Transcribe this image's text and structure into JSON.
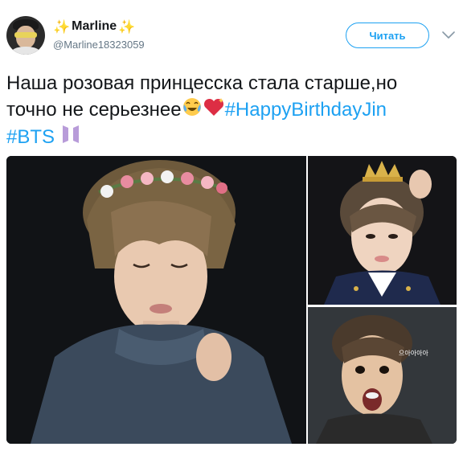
{
  "user": {
    "display_name": "Marline",
    "handle": "@Marline18323059",
    "name_prefix_icon": "sparkles-icon",
    "name_suffix_icon": "sparkles-icon"
  },
  "follow_button": {
    "label": "Читать"
  },
  "menu": {
    "icon": "chevron-down-icon"
  },
  "tweet": {
    "line1": "Наша розовая принцесска стала старше,но",
    "line2_text": "точно не серьезнее",
    "emoji_1": "crying-laughing-face-icon",
    "emoji_2": "sparkling-heart-icon",
    "hashtag_1": "#HappyBirthdayJin",
    "hashtag_2": "#BTS",
    "emoji_3": "bts-logo-icon"
  },
  "media": {
    "images": [
      "photo-flower-crown",
      "photo-crown",
      "photo-surprised"
    ],
    "caption_korean": "으아아아아"
  },
  "colors": {
    "accent": "#1da1f2",
    "text": "#14171a",
    "muted": "#657786",
    "sparkle": "#f5c518"
  }
}
